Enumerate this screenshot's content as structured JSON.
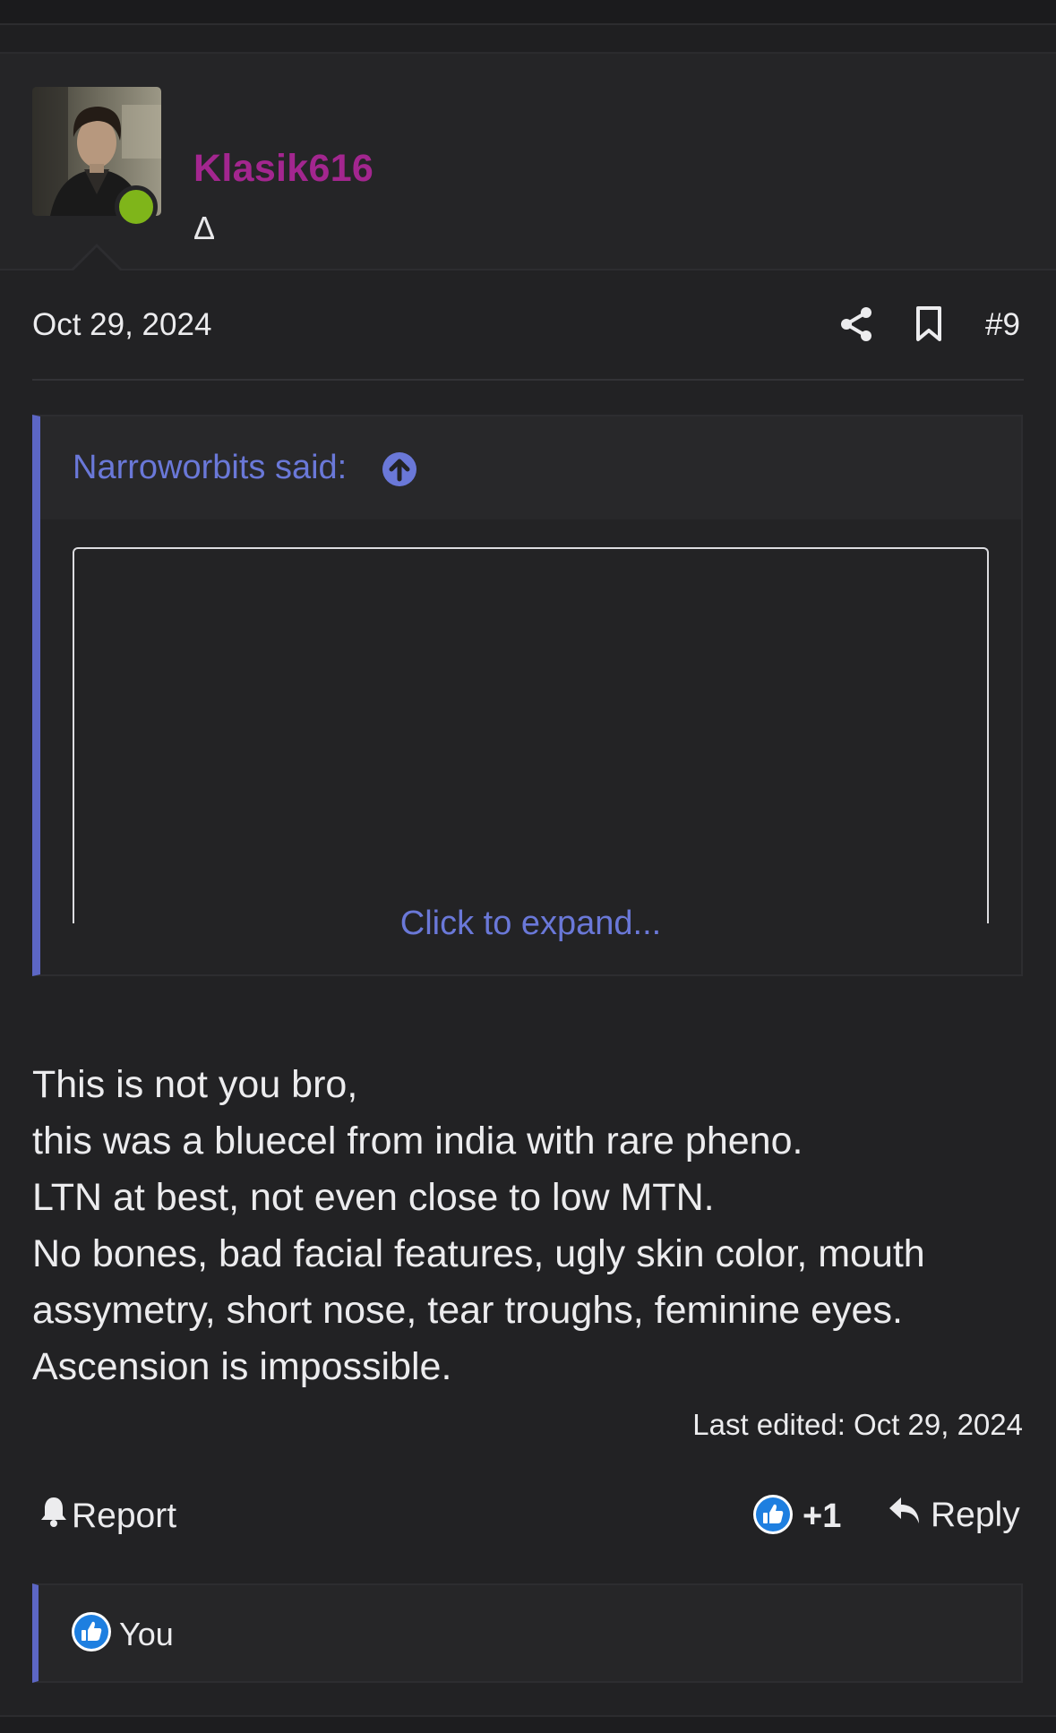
{
  "post": {
    "author": {
      "name": "Klasik616",
      "title": "Δ",
      "online": true
    },
    "date": "Oct 29, 2024",
    "number": "#9",
    "quote": {
      "author_label": "Narroworbits said:",
      "expand_label": "Click to expand..."
    },
    "body": {
      "lines": [
        "This is not you bro,",
        "this was a bluecel from india with rare pheno.",
        "LTN at best, not even close to low MTN.",
        "No bones, bad facial features, ugly skin color, mouth",
        "assymetry, short nose, tear troughs, feminine eyes.",
        "Ascension is impossible."
      ]
    },
    "last_edited": "Last edited: Oct 29, 2024",
    "actions": {
      "report_label": "Report",
      "reaction_count": "+1",
      "reply_label": "Reply"
    },
    "reactions": {
      "list_label": "You"
    }
  },
  "colors": {
    "username": "#a3268f",
    "link": "#6a78d8",
    "accent_bar": "#5c66c4",
    "online": "#7fb51a",
    "like": "#1e7fe0"
  },
  "icons": [
    "share-icon",
    "bookmark-icon",
    "arrow-up-circle-icon",
    "bell-icon",
    "like-icon",
    "reply-icon"
  ]
}
